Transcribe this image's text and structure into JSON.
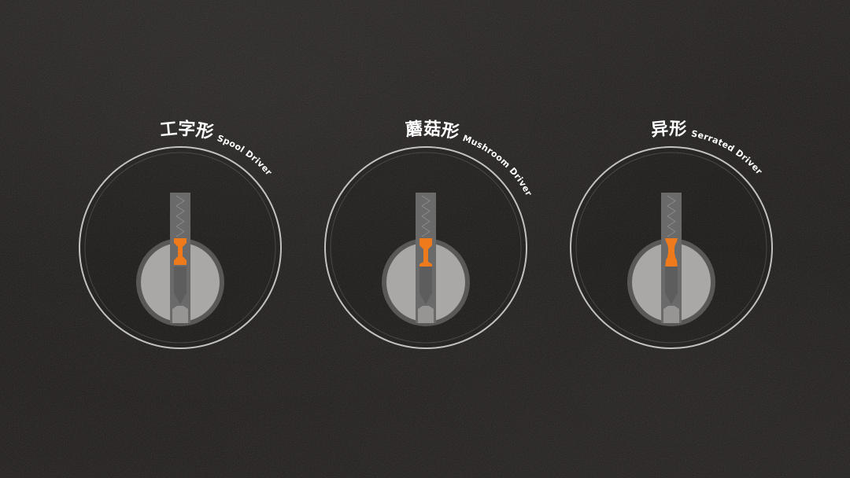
{
  "pin_types": [
    {
      "cn": "工字形",
      "en": "Spool Driver"
    },
    {
      "cn": "蘑菇形",
      "en": "Mushroom Driver"
    },
    {
      "cn": "异形",
      "en": "Serrated Driver"
    }
  ],
  "colors": {
    "background": "#1d1a18",
    "ring": "#dcdcdc",
    "plug": "#a9a8a6",
    "housing_column": "#6a6a6a",
    "driver_pin": "#ee7a1c",
    "key_pin": "#5d5d5d",
    "text": "#ffffff"
  },
  "icons": [
    "lock-cylinder-icon",
    "spring-icon",
    "driver-pin-icon",
    "key-pin-icon"
  ]
}
